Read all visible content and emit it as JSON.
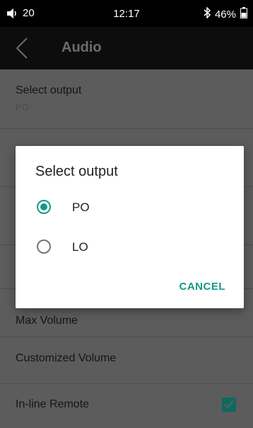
{
  "status_bar": {
    "volume": "20",
    "time": "12:17",
    "battery": "46%"
  },
  "header": {
    "title": "Audio"
  },
  "settings": {
    "select_output": {
      "label": "Select output",
      "value": "PO"
    },
    "max_volume": {
      "label": "Max Volume"
    },
    "customized_volume": {
      "label": "Customized Volume"
    },
    "inline_remote": {
      "label": "In-line Remote",
      "checked": true
    }
  },
  "dialog": {
    "title": "Select output",
    "options": [
      {
        "label": "PO",
        "selected": true
      },
      {
        "label": "LO",
        "selected": false
      }
    ],
    "cancel_label": "CANCEL"
  },
  "colors": {
    "accent": "#139a88",
    "scrim_background": "#5c5c5c",
    "status_bar": "#000000"
  }
}
